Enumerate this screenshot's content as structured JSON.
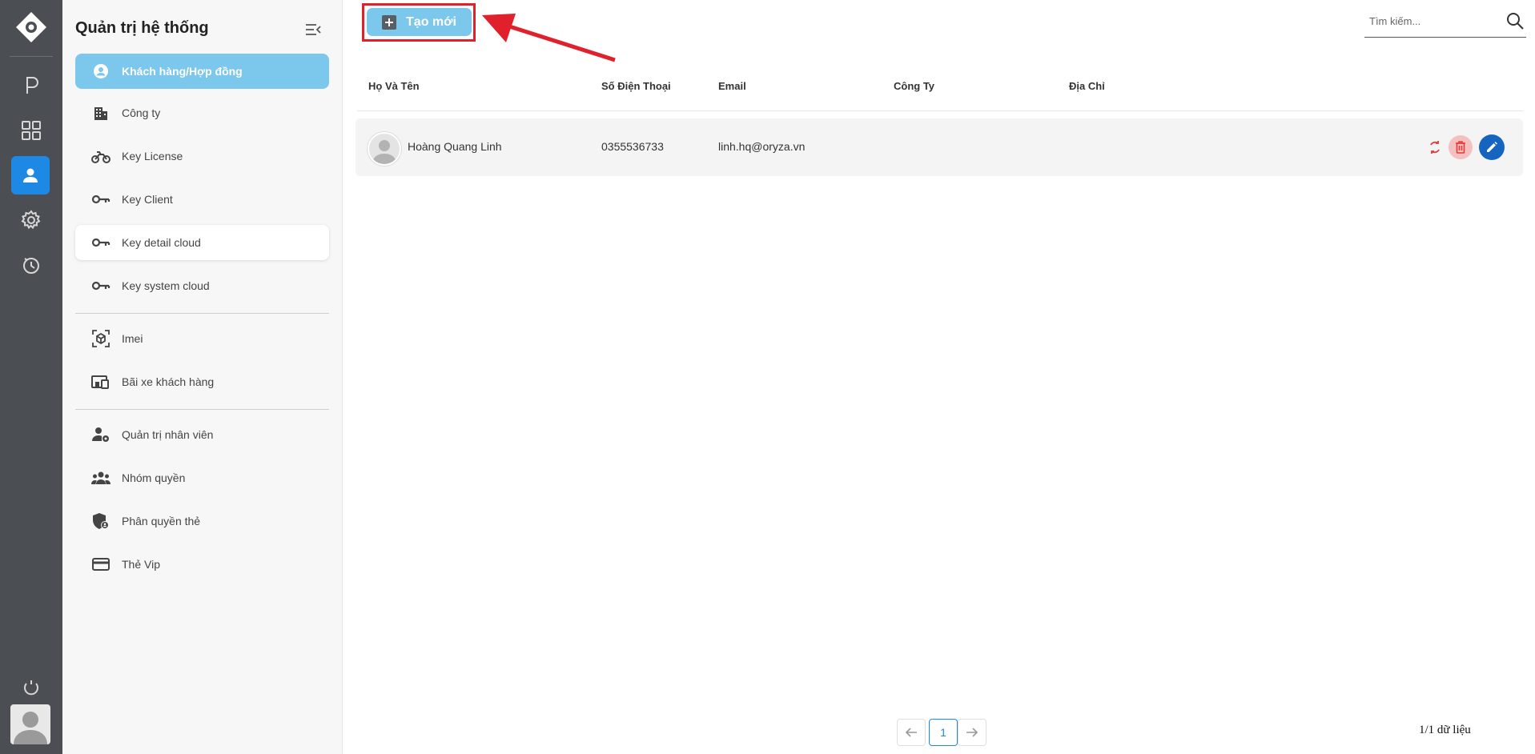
{
  "rail": {
    "icons": [
      "logo-icon",
      "parking-icon",
      "dashboard-grid-icon",
      "user-icon",
      "settings-icon",
      "clock-history-icon",
      "sync-icon"
    ],
    "active": "user-icon"
  },
  "sidebar": {
    "title": "Quản trị hệ thống",
    "items": [
      {
        "label": "Khách hàng/Hợp đồng",
        "icon": "account-circle-icon"
      },
      {
        "label": "Công ty",
        "icon": "building-icon"
      },
      {
        "label": "Key License",
        "icon": "motorbike-icon"
      },
      {
        "label": "Key Client",
        "icon": "key-icon"
      },
      {
        "label": "Key detail cloud",
        "icon": "key-icon"
      },
      {
        "label": "Key system cloud",
        "icon": "key-icon"
      },
      {
        "label": "Imei",
        "icon": "scan-cube-icon"
      },
      {
        "label": "Bãi xe khách hàng",
        "icon": "devices-icon"
      },
      {
        "label": "Quản trị nhân viên",
        "icon": "user-cog-icon"
      },
      {
        "label": "Nhóm quyền",
        "icon": "group-icon"
      },
      {
        "label": "Phân quyền thẻ",
        "icon": "shield-user-icon"
      },
      {
        "label": "Thẻ Vip",
        "icon": "credit-card-icon"
      }
    ]
  },
  "toolbar": {
    "create_label": "Tạo mới",
    "search_placeholder": "Tìm kiếm..."
  },
  "table": {
    "columns": [
      "Họ Và Tên",
      "Số Điện Thoại",
      "Email",
      "Công Ty",
      "Địa Chỉ"
    ],
    "rows": [
      {
        "name": "Hoàng Quang Linh",
        "phone": "0355536733",
        "email": "linh.hq@oryza.vn",
        "company": "",
        "address": ""
      }
    ]
  },
  "pagination": {
    "current_page": "1",
    "summary": "1/1 dữ liệu"
  },
  "colors": {
    "rail_bg": "#4b4e52",
    "accent": "#7cc7ec",
    "active_rail": "#1e88e5",
    "highlight": "#e0202a"
  }
}
